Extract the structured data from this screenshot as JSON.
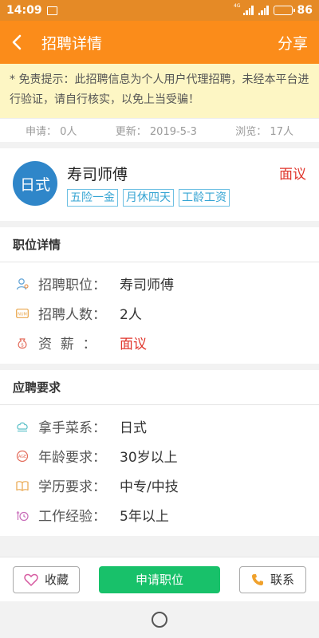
{
  "status_bar": {
    "time": "14:09",
    "network": "4G",
    "battery": "86",
    "battery_level": 0.86
  },
  "nav": {
    "title": "招聘详情",
    "share": "分享"
  },
  "notice": "* 免责提示：此招聘信息为个人用户代理招聘，未经本平台进行验证，请自行核实，以免上当受骗！",
  "stats": {
    "applied": "申请：  0人",
    "updated": "更新：  2019-5-3",
    "views": "浏览：  17人"
  },
  "job": {
    "logo_text": "日式",
    "name": "寿司师傅",
    "salary": "面议",
    "tags": [
      "五险一金",
      "月休四天",
      "工龄工资"
    ]
  },
  "position_details": {
    "title": "职位详情",
    "rows": [
      {
        "icon": "person-icon",
        "label": "招聘职位：",
        "value": "寿司师傅"
      },
      {
        "icon": "number-icon",
        "label": "招聘人数：",
        "value": "2人"
      },
      {
        "icon": "money-bag-icon",
        "label": "资  薪  ：",
        "value": "面议"
      }
    ]
  },
  "requirements": {
    "title": "应聘要求",
    "rows": [
      {
        "icon": "chef-hat-icon",
        "label": "拿手菜系：",
        "value": "日式"
      },
      {
        "icon": "age-icon",
        "label": "年龄要求：",
        "value": "30岁以上"
      },
      {
        "icon": "book-icon",
        "label": "学历要求：",
        "value": "中专/中技"
      },
      {
        "icon": "experience-icon",
        "label": "工作经验：",
        "value": "5年以上"
      }
    ]
  },
  "bottom": {
    "favorite": "收藏",
    "apply": "申请职位",
    "contact": "联系"
  },
  "colors": {
    "accent": "#fb8c1a",
    "salary": "#e0362c",
    "apply": "#18c16a",
    "tag": "#35a4d3",
    "logo": "#2f86c9"
  }
}
